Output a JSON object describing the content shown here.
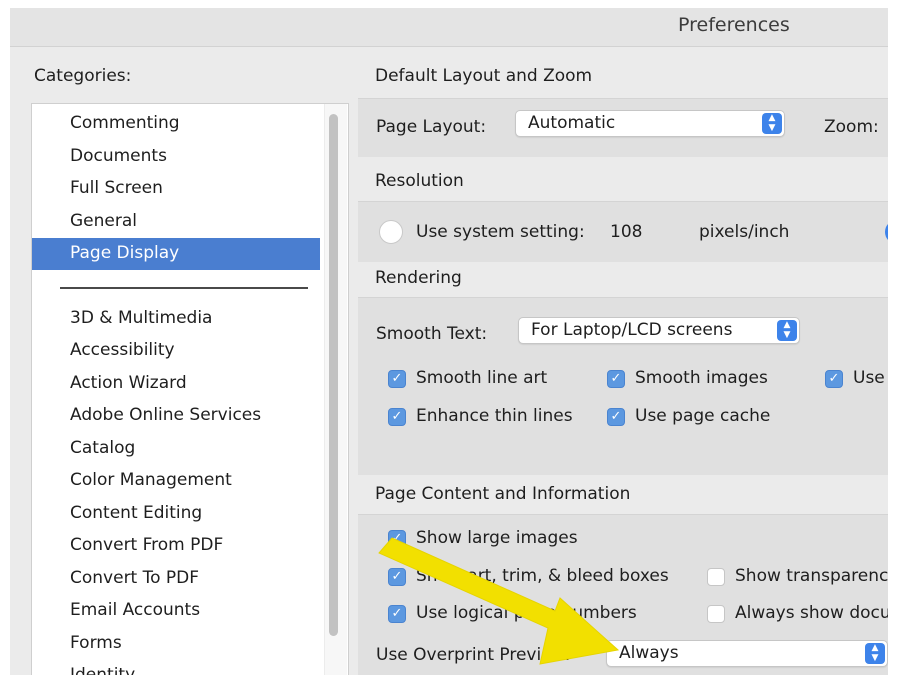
{
  "window": {
    "title": "Preferences"
  },
  "categories": {
    "label": "Categories:",
    "group1": [
      "Commenting",
      "Documents",
      "Full Screen",
      "General",
      "Page Display"
    ],
    "selected": "Page Display",
    "group2": [
      "3D & Multimedia",
      "Accessibility",
      "Action Wizard",
      "Adobe Online Services",
      "Catalog",
      "Color Management",
      "Content Editing",
      "Convert From PDF",
      "Convert To PDF",
      "Email Accounts",
      "Forms",
      "Identity"
    ]
  },
  "layout_zoom": {
    "section": "Default Layout and Zoom",
    "page_layout_label": "Page Layout:",
    "page_layout_value": "Automatic",
    "zoom_label": "Zoom:"
  },
  "resolution": {
    "section": "Resolution",
    "system_label": "Use system setting:",
    "system_value": "108",
    "unit": "pixels/inch"
  },
  "rendering": {
    "section": "Rendering",
    "smooth_text_label": "Smooth Text:",
    "smooth_text_value": "For Laptop/LCD screens",
    "smooth_line_art": "Smooth line art",
    "smooth_images": "Smooth images",
    "use_local_fonts": "Use l",
    "enhance_thin_lines": "Enhance thin lines",
    "use_page_cache": "Use page cache"
  },
  "page_content": {
    "section": "Page Content and Information",
    "show_large_images": "Show large images",
    "show_boxes": "Show art, trim, & bleed boxes",
    "show_transparency": "Show transparenc",
    "use_logical_page_numbers": "Use logical page numbers",
    "always_show_doc": "Always show docu",
    "overprint_label": "Use Overprint Preview:",
    "overprint_value": "Always"
  },
  "colors": {
    "selection": "#4a7ed0",
    "accent": "#3d83ea",
    "annotation_arrow": "#f2e000"
  }
}
